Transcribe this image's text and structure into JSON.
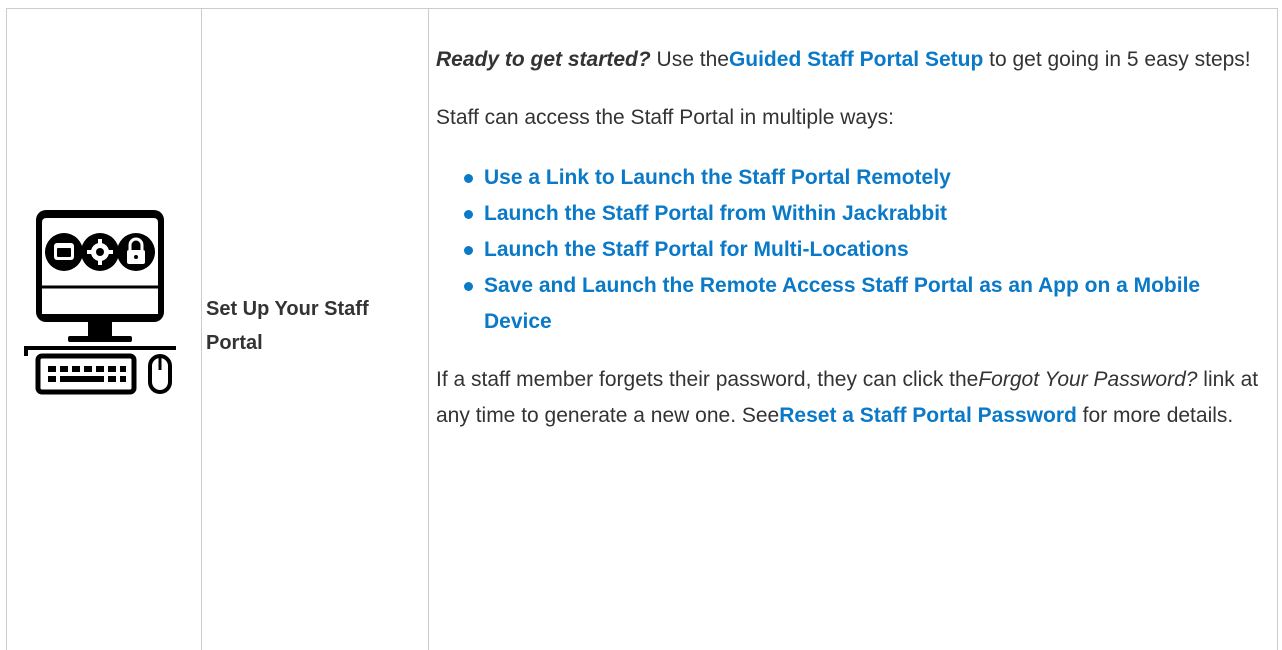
{
  "row": {
    "label": "Set Up Your Staff Portal",
    "icon": "computer-settings-lock-icon"
  },
  "intro": {
    "emphasis": "Ready to get started?",
    "text_before_link": " Use the",
    "link": "Guided Staff Portal Setup",
    "text_after_link": " to get going in 5 easy steps!"
  },
  "ways_intro": "Staff can access the Staff Portal in multiple ways:",
  "ways_links": [
    "Use a Link to Launch the Staff Portal Remotely",
    "Launch the Staff Portal from Within Jackrabbit",
    "Launch the Staff Portal for Multi-Locations",
    "Save and Launch the Remote Access Staff Portal as an App on a Mobile Device"
  ],
  "forgot": {
    "text_before": "If a staff member forgets their password, they can click the",
    "italic": "Forgot Your Password?",
    "text_middle": "  link at any time to generate a new one. See",
    "link": "Reset a Staff Portal Password",
    "text_after": " for more details."
  },
  "colors": {
    "link": "#0a7ac8",
    "text": "#333333",
    "border": "#cccccc",
    "icon": "#000000"
  }
}
